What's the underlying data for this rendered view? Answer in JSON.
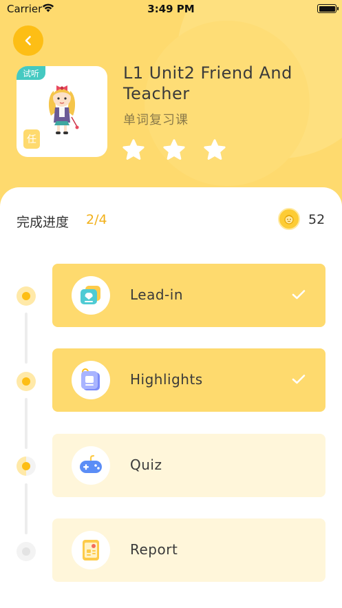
{
  "status_bar": {
    "carrier": "Carrier",
    "time": "3:49 PM"
  },
  "lesson": {
    "title": "L1 Unit2 Friend And Teacher",
    "subtitle": "单词复习课",
    "trial_tag": "试听",
    "task_badge": "任",
    "stars_total": 3,
    "stars_earned": 0
  },
  "progress": {
    "label": "完成进度",
    "value": "2/4",
    "coins": "52"
  },
  "steps": [
    {
      "label": "Lead-in",
      "status": "completed",
      "icon": "chat-icon"
    },
    {
      "label": "Highlights",
      "status": "completed",
      "icon": "card-icon"
    },
    {
      "label": "Quiz",
      "status": "current",
      "icon": "gamepad-icon"
    },
    {
      "label": "Report",
      "status": "locked",
      "icon": "report-icon"
    }
  ],
  "colors": {
    "header": "#FEDA6E",
    "accent": "#FDBE15",
    "progress_text": "#F2B01A",
    "card_done": "#FEDA6E",
    "card_todo": "#FFF6DA"
  }
}
